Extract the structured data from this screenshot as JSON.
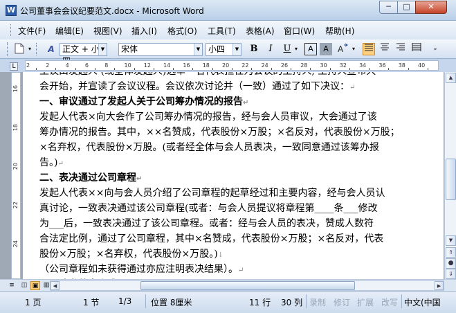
{
  "window": {
    "title": "公司董事会会议纪要范文.docx - Microsoft Word",
    "app_icon": "W",
    "minimize_label": "─",
    "maximize_label": "□",
    "close_label": "✕"
  },
  "menu": {
    "items": [
      "文件(F)",
      "编辑(E)",
      "视图(V)",
      "插入(I)",
      "格式(O)",
      "工具(T)",
      "表格(A)",
      "窗口(W)",
      "帮助(H)"
    ]
  },
  "toolbar": {
    "style_value": "正文 + 小四",
    "font_value": "宋体",
    "size_value": "小四",
    "bold_label": "B",
    "italic_label": "I",
    "underline_label": "U",
    "char_border_label": "A",
    "char_shading_label": "A"
  },
  "ruler": {
    "numbers": [
      "2",
      "2",
      "4",
      "6",
      "8",
      "10",
      "12",
      "14",
      "16",
      "18",
      "20",
      "22",
      "24",
      "26",
      "28",
      "30",
      "32",
      "34",
      "36",
      "38",
      "40"
    ],
    "vertical_numbers": [
      "16",
      "18",
      "20",
      "22",
      "24",
      "26"
    ]
  },
  "document": {
    "lines": [
      {
        "text": "主议由发起人 (或全体发起人)选举一名代表担任为会议的主持人, 主持人宣布大",
        "bold": false,
        "mark": ""
      },
      {
        "text": "会开始，并宣读了会议议程。会议依次讨论并（一致）通过了如下决议：",
        "bold": false,
        "mark": "↵"
      },
      {
        "text": "一、审议通过了发起人关于公司筹办情况的报告",
        "bold": true,
        "mark": "↵"
      },
      {
        "text": "发起人代表×向大会作了公司筹办情况的报告，经与会人员审议，大会通过了该",
        "bold": false,
        "mark": ""
      },
      {
        "text": "筹办情况的报告。其中，××名赞成，代表股份×万股；×名反对，代表股份×万股；",
        "bold": false,
        "mark": ""
      },
      {
        "text": "×名弃权，代表股份×万股。(或者经全体与会人员表决，一致同意通过该筹办报",
        "bold": false,
        "mark": ""
      },
      {
        "text": "告。)",
        "bold": false,
        "mark": "↵"
      },
      {
        "text": "二、表决通过公司章程",
        "bold": true,
        "mark": "↵"
      },
      {
        "text": "发起人代表××向与会人员介绍了公司章程的起草经过和主要内容，经与会人员认",
        "bold": false,
        "mark": ""
      },
      {
        "text": "真讨论，一致表决通过该公司章程(或者：与会人员提议将章程第____条___修改",
        "bold": false,
        "mark": ""
      },
      {
        "text": "为___后，一致表决通过了该公司章程。或者：经与会人员的表决，赞成人数符",
        "bold": false,
        "mark": ""
      },
      {
        "text": "合法定比例，通过了公司章程，其中×名赞成，代表股份×万股；×名反对，代表",
        "bold": false,
        "mark": ""
      },
      {
        "text": "股份×万股；×名弃权，代表股份×万股。)",
        "bold": false,
        "mark": "↓"
      },
      {
        "text": "（公司章程如未获得通过亦应注明表决结果）。",
        "bold": false,
        "mark": "↵"
      },
      {
        "text": "三、选举董事会成员",
        "bold": true,
        "mark": "↵"
      }
    ]
  },
  "status": {
    "page": "1 页",
    "section": "1 节",
    "page_of": "1/3",
    "position": "位置 8厘米",
    "line": "11 行",
    "column": "30 列",
    "record": "录制",
    "revision": "修订",
    "extend": "扩展",
    "overwrite": "改写",
    "language": "中文(中国"
  }
}
